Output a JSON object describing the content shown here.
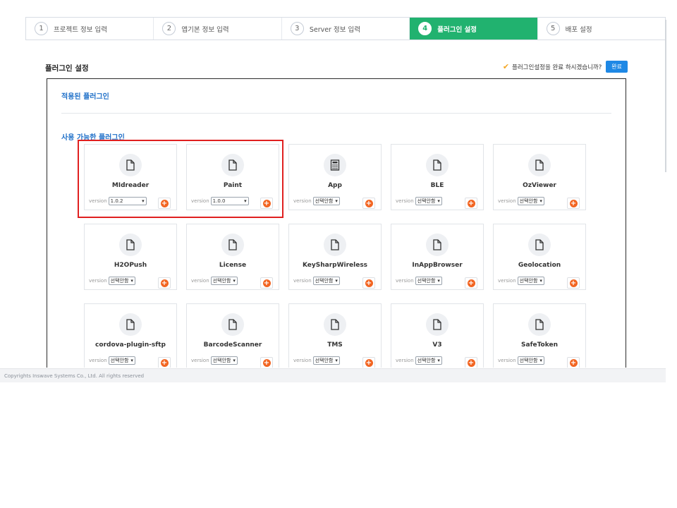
{
  "stepper": {
    "steps": [
      {
        "num": "1",
        "label": "프로젝트 정보 입력"
      },
      {
        "num": "2",
        "label": "앱기본 정보 입력"
      },
      {
        "num": "3",
        "label": "Server 정보 입력"
      },
      {
        "num": "4",
        "label": "플러그인 설정"
      },
      {
        "num": "5",
        "label": "배포 설정"
      }
    ],
    "active_index": 3
  },
  "header": {
    "title": "플러그인 설정",
    "confirm_text": "플러그인설정을 완료 하시겠습니까?",
    "done_button": "완료"
  },
  "panel": {
    "applied_title": "적용된 플러그인",
    "available_title": "사용 가능한 플러그인"
  },
  "plugins": [
    {
      "name": "MIdreader",
      "version_label": "version",
      "version": "1.0.2",
      "icon": "file-icon"
    },
    {
      "name": "Paint",
      "version_label": "version",
      "version": "1.0.0",
      "icon": "file-icon"
    },
    {
      "name": "App",
      "version_label": "version",
      "version": "선택안함",
      "icon": "calculator-icon"
    },
    {
      "name": "BLE",
      "version_label": "version",
      "version": "선택안함",
      "icon": "file-icon"
    },
    {
      "name": "OzViewer",
      "version_label": "version",
      "version": "선택안함",
      "icon": "file-icon"
    },
    {
      "name": "H2OPush",
      "version_label": "version",
      "version": "선택안함",
      "icon": "file-icon"
    },
    {
      "name": "License",
      "version_label": "version",
      "version": "선택안함",
      "icon": "file-icon"
    },
    {
      "name": "KeySharpWireless",
      "version_label": "version",
      "version": "선택안함",
      "icon": "file-icon"
    },
    {
      "name": "InAppBrowser",
      "version_label": "version",
      "version": "선택안함",
      "icon": "file-icon"
    },
    {
      "name": "Geolocation",
      "version_label": "version",
      "version": "선택안함",
      "icon": "file-icon"
    },
    {
      "name": "cordova-plugin-sftp",
      "version_label": "version",
      "version": "선택안함",
      "icon": "file-icon"
    },
    {
      "name": "BarcodeScanner",
      "version_label": "version",
      "version": "선택안함",
      "icon": "file-icon"
    },
    {
      "name": "TMS",
      "version_label": "version",
      "version": "선택안함",
      "icon": "file-icon"
    },
    {
      "name": "V3",
      "version_label": "version",
      "version": "선택안함",
      "icon": "file-icon"
    },
    {
      "name": "SafeToken",
      "version_label": "version",
      "version": "선택안함",
      "icon": "file-icon"
    }
  ],
  "colors": {
    "active_step": "#21b26f",
    "link_blue": "#1e6fc8",
    "add_orange": "#f26522",
    "highlight_red": "#e02020",
    "done_blue": "#1e88e5"
  },
  "footer": {
    "text": "Copyrights Inswave Systems Co., Ltd. All rights reserved"
  }
}
